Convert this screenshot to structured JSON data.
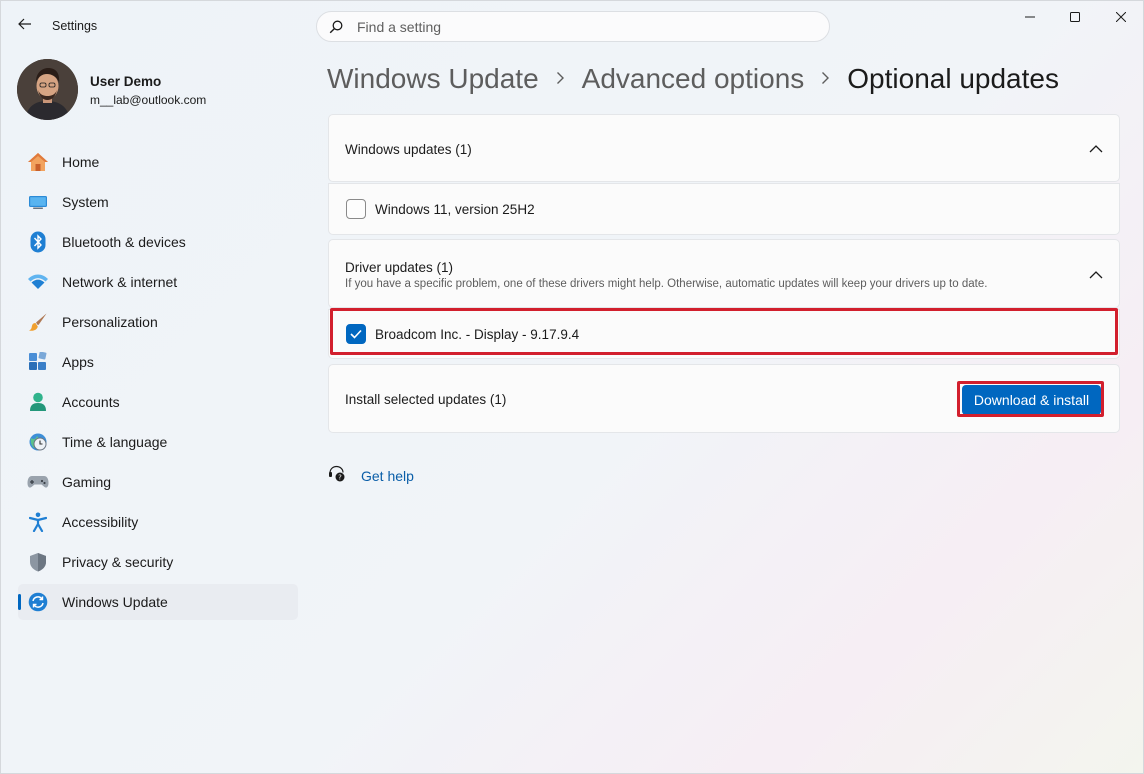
{
  "window": {
    "app_title": "Settings"
  },
  "search": {
    "placeholder": "Find a setting"
  },
  "profile": {
    "name": "User Demo",
    "email": "m__lab@outlook.com"
  },
  "sidebar": {
    "items": [
      {
        "label": "Home",
        "icon": "home-icon"
      },
      {
        "label": "System",
        "icon": "system-icon"
      },
      {
        "label": "Bluetooth & devices",
        "icon": "bluetooth-icon"
      },
      {
        "label": "Network & internet",
        "icon": "wifi-icon"
      },
      {
        "label": "Personalization",
        "icon": "brush-icon"
      },
      {
        "label": "Apps",
        "icon": "apps-icon"
      },
      {
        "label": "Accounts",
        "icon": "accounts-icon"
      },
      {
        "label": "Time & language",
        "icon": "time-language-icon"
      },
      {
        "label": "Gaming",
        "icon": "gamepad-icon"
      },
      {
        "label": "Accessibility",
        "icon": "accessibility-icon"
      },
      {
        "label": "Privacy & security",
        "icon": "shield-icon"
      },
      {
        "label": "Windows Update",
        "icon": "windows-update-icon",
        "active": true
      }
    ]
  },
  "breadcrumb": {
    "items": [
      "Windows Update",
      "Advanced options",
      "Optional updates"
    ]
  },
  "windows_updates": {
    "title": "Windows updates (1)",
    "items": [
      {
        "label": "Windows 11, version 25H2",
        "checked": false
      }
    ]
  },
  "driver_updates": {
    "title": "Driver updates (1)",
    "description": "If you have a specific problem, one of these drivers might help. Otherwise, automatic updates will keep your drivers up to date.",
    "items": [
      {
        "label": "Broadcom Inc. - Display - 9.17.9.4",
        "checked": true
      }
    ]
  },
  "install": {
    "label": "Install selected updates (1)",
    "button_label": "Download & install"
  },
  "help": {
    "label": "Get help"
  },
  "colors": {
    "accent": "#0067c0",
    "highlight": "#d21f2d"
  }
}
